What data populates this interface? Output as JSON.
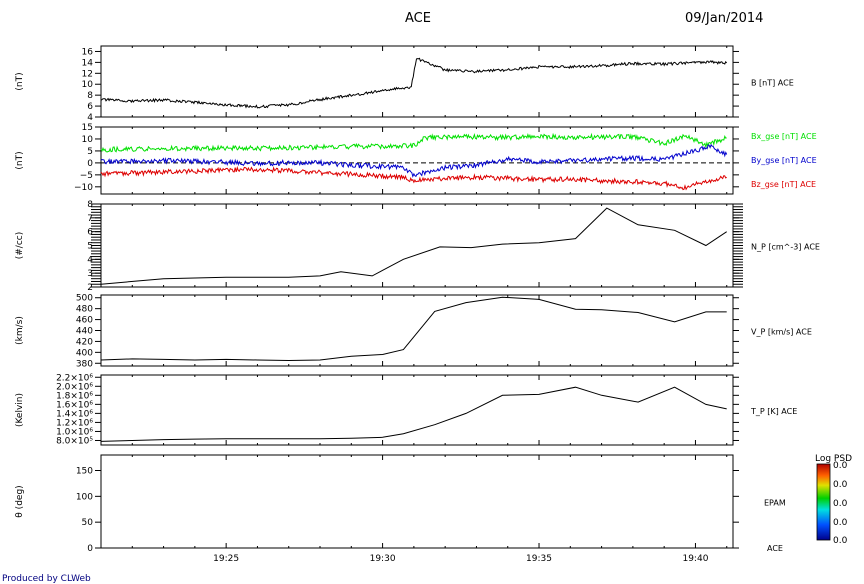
{
  "header": {
    "title": "ACE",
    "date": "09/Jan/2014"
  },
  "footer": {
    "credit": "Produced by CLWeb"
  },
  "time_axis": {
    "ticks": [
      "19:25",
      "19:30",
      "19:35",
      "19:40"
    ]
  },
  "colorbar": {
    "title": "Log PSD",
    "labels": [
      "0.0",
      "0.0",
      "0.0",
      "0.0",
      "0.0"
    ]
  },
  "chart_data": [
    {
      "type": "line",
      "ylabel": "(nT)",
      "ylim": [
        4,
        17
      ],
      "yticks": [
        "4",
        "6",
        "8",
        "10",
        "12",
        "14",
        "16"
      ],
      "series": [
        {
          "name": "B [nT] ACE",
          "color": "#000000",
          "x": [
            "19:21:00",
            "19:22:00",
            "19:23:00",
            "19:24:00",
            "19:25:00",
            "19:25:40",
            "19:26:00",
            "19:27:00",
            "19:28:00",
            "19:29:00",
            "19:30:00",
            "19:30:55",
            "19:31:05",
            "19:31:30",
            "19:32:00",
            "19:33:00",
            "19:34:00",
            "19:35:00",
            "19:36:00",
            "19:37:00",
            "19:38:00",
            "19:39:00",
            "19:39:50",
            "19:40:20",
            "19:41:00"
          ],
          "y": [
            7.2,
            6.9,
            7.1,
            6.7,
            6.2,
            6.0,
            5.9,
            6.2,
            7.2,
            8.0,
            8.8,
            9.5,
            14.7,
            13.8,
            12.6,
            12.3,
            12.6,
            13.2,
            13.2,
            13.4,
            13.8,
            13.7,
            13.9,
            14.1,
            13.9
          ]
        }
      ]
    },
    {
      "type": "line",
      "ylabel": "(nT)",
      "ylim": [
        -13,
        15
      ],
      "yticks": [
        "−10",
        "−5",
        "0",
        "5",
        "10",
        "15"
      ],
      "series": [
        {
          "name": "Bx_gse [nT] ACE",
          "color": "#00e000",
          "x": [
            "19:21:00",
            "19:22:00",
            "19:23:00",
            "19:24:00",
            "19:25:00",
            "19:26:00",
            "19:27:00",
            "19:28:00",
            "19:29:00",
            "19:30:00",
            "19:31:00",
            "19:31:20",
            "19:32:00",
            "19:33:00",
            "19:34:00",
            "19:35:00",
            "19:36:00",
            "19:37:00",
            "19:38:00",
            "19:39:00",
            "19:39:40",
            "19:40:20",
            "19:41:00"
          ],
          "y": [
            5.5,
            5.8,
            5.9,
            6.0,
            6.2,
            6.1,
            6.3,
            6.6,
            6.8,
            7.0,
            7.2,
            10.5,
            10.8,
            10.9,
            10.6,
            11.0,
            10.7,
            10.9,
            11.0,
            8.0,
            11.5,
            7.5,
            10.5
          ]
        },
        {
          "name": "By_gse [nT] ACE",
          "color": "#0000cc",
          "x": [
            "19:21:00",
            "19:22:00",
            "19:23:00",
            "19:24:00",
            "19:25:00",
            "19:26:00",
            "19:27:00",
            "19:28:00",
            "19:29:00",
            "19:30:00",
            "19:30:40",
            "19:31:00",
            "19:31:40",
            "19:32:00",
            "19:33:00",
            "19:34:00",
            "19:35:00",
            "19:36:00",
            "19:37:00",
            "19:38:00",
            "19:39:00",
            "19:39:40",
            "19:40:30",
            "19:41:00"
          ],
          "y": [
            0.5,
            0.8,
            1.0,
            0.6,
            0.3,
            -0.5,
            0.2,
            0.0,
            -1.0,
            -1.5,
            -2.0,
            -5.0,
            -3.5,
            -2.0,
            -1.0,
            1.5,
            0.5,
            1.0,
            1.5,
            2.0,
            1.5,
            4.0,
            7.0,
            3.5
          ]
        },
        {
          "name": "Bz_gse [nT] ACE",
          "color": "#dd0000",
          "x": [
            "19:21:00",
            "19:22:00",
            "19:23:00",
            "19:24:00",
            "19:25:00",
            "19:26:00",
            "19:27:00",
            "19:28:00",
            "19:29:00",
            "19:30:00",
            "19:30:40",
            "19:31:00",
            "19:32:00",
            "19:33:00",
            "19:34:00",
            "19:35:00",
            "19:36:00",
            "19:37:00",
            "19:38:00",
            "19:39:00",
            "19:39:40",
            "19:40:00",
            "19:41:00"
          ],
          "y": [
            -4.5,
            -4.2,
            -3.8,
            -3.5,
            -3.0,
            -2.8,
            -3.2,
            -4.0,
            -4.8,
            -5.5,
            -6.0,
            -7.5,
            -6.5,
            -6.0,
            -6.5,
            -7.0,
            -6.8,
            -7.5,
            -7.8,
            -8.5,
            -10.5,
            -8.5,
            -6.0
          ]
        }
      ],
      "reference_line_y": 0
    },
    {
      "type": "line",
      "ylabel": "(#/cc)",
      "ylim": [
        2,
        8
      ],
      "yticks": [
        "2",
        "3",
        "4",
        "5",
        "6",
        "7",
        "8"
      ],
      "series": [
        {
          "name": "N_P [cm^-3] ACE",
          "color": "#000000",
          "x": [
            "19:21:00",
            "19:23:00",
            "19:25:00",
            "19:27:00",
            "19:28:00",
            "19:28:40",
            "19:29:40",
            "19:30:40",
            "19:31:50",
            "19:32:50",
            "19:33:50",
            "19:35:00",
            "19:36:10",
            "19:37:10",
            "19:38:10",
            "19:39:20",
            "19:40:20",
            "19:41:00"
          ],
          "y": [
            2.2,
            2.6,
            2.7,
            2.7,
            2.8,
            3.1,
            2.8,
            4.0,
            4.9,
            4.85,
            5.1,
            5.2,
            5.5,
            7.7,
            6.5,
            6.1,
            5.0,
            6.0
          ]
        }
      ]
    },
    {
      "type": "line",
      "ylabel": "(km/s)",
      "ylim": [
        375,
        505
      ],
      "yticks": [
        "380",
        "400",
        "420",
        "440",
        "460",
        "480",
        "500"
      ],
      "series": [
        {
          "name": "V_P [km/s] ACE",
          "color": "#000000",
          "x": [
            "19:21:00",
            "19:22:00",
            "19:23:00",
            "19:24:00",
            "19:25:00",
            "19:26:00",
            "19:27:00",
            "19:28:00",
            "19:29:00",
            "19:30:00",
            "19:30:40",
            "19:31:40",
            "19:32:40",
            "19:33:50",
            "19:35:00",
            "19:36:10",
            "19:37:00",
            "19:38:10",
            "19:39:20",
            "19:40:20",
            "19:41:00"
          ],
          "y": [
            386,
            388,
            387,
            386,
            387,
            386,
            385,
            386,
            393,
            396,
            405,
            475,
            491,
            501,
            497,
            479,
            478,
            473,
            456,
            474,
            474
          ]
        }
      ]
    },
    {
      "type": "line",
      "ylabel": "(Kelvin)",
      "ylim": [
        700000,
        2250000
      ],
      "yticks": [
        "8.0×10⁵",
        "1.0×10⁶",
        "1.2×10⁶",
        "1.4×10⁶",
        "1.6×10⁶",
        "1.8×10⁶",
        "2.0×10⁶",
        "2.2×10⁶"
      ],
      "series": [
        {
          "name": "T_P [K] ACE",
          "color": "#000000",
          "x": [
            "19:21:00",
            "19:22:00",
            "19:23:00",
            "19:24:00",
            "19:25:00",
            "19:26:00",
            "19:27:00",
            "19:28:00",
            "19:29:00",
            "19:30:00",
            "19:30:40",
            "19:31:40",
            "19:32:40",
            "19:33:50",
            "19:35:00",
            "19:36:10",
            "19:37:00",
            "19:38:10",
            "19:39:20",
            "19:40:20",
            "19:41:00"
          ],
          "y": [
            780000,
            800000,
            820000,
            830000,
            840000,
            840000,
            840000,
            840000,
            850000,
            870000,
            950000,
            1150000,
            1400000,
            1800000,
            1820000,
            1980000,
            1800000,
            1650000,
            1980000,
            1600000,
            1500000
          ]
        }
      ]
    },
    {
      "type": "heatmap",
      "ylabel": "θ (deg)",
      "ylim": [
        0,
        180
      ],
      "yticks": [
        "0",
        "50",
        "100",
        "150"
      ],
      "right_labels": [
        "ACE",
        "EPAM"
      ],
      "series": []
    }
  ]
}
